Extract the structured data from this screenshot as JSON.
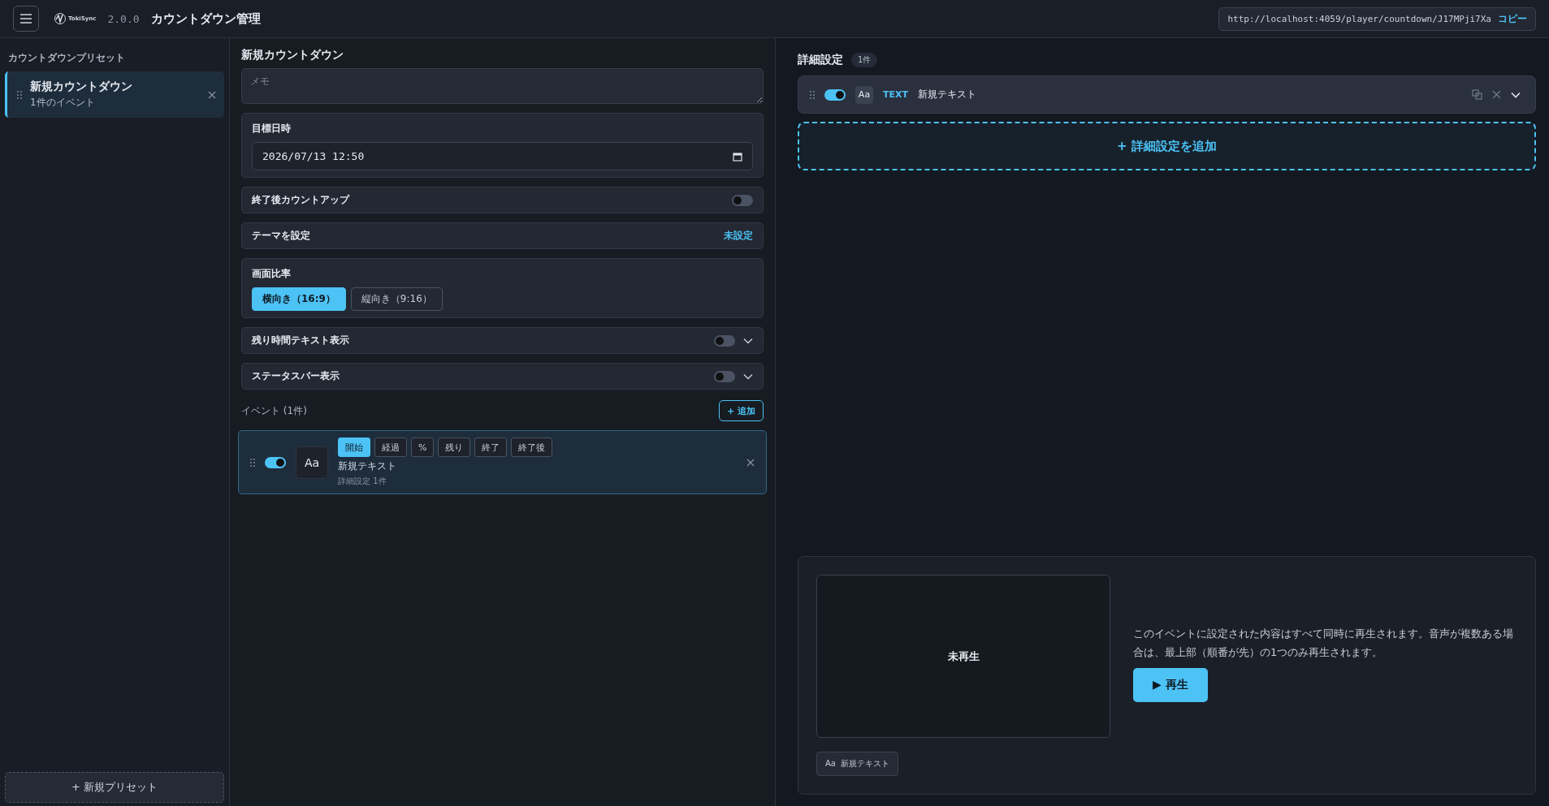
{
  "header": {
    "logo_text": "TokiSync",
    "version": "2.0.0",
    "title": "カウントダウン管理",
    "url": "http://localhost:4059/player/countdown/J17MPji7Xa",
    "copy_label": "コピー"
  },
  "sidebar": {
    "title": "カウントダウンプリセット",
    "presets": [
      {
        "name": "新規カウントダウン",
        "subtitle": "1件のイベント",
        "selected": true
      }
    ],
    "new_button": "+ 新規プリセット"
  },
  "editor": {
    "title": "新規カウントダウン",
    "memo": {
      "placeholder": "メモ"
    },
    "target": {
      "label": "目標日時",
      "value": "2026/07/13 12:50"
    },
    "settings": [
      {
        "kind": "toggle",
        "label": "終了後カウントアップ",
        "on": false
      },
      {
        "kind": "link",
        "label": "テーマを設定",
        "value": "未設定"
      },
      {
        "kind": "ratio",
        "label": "画面比率",
        "options": [
          {
            "label": "横向き（16:9）",
            "selected": true
          },
          {
            "label": "縦向き（9:16）",
            "selected": false
          }
        ]
      },
      {
        "kind": "toggle_expand",
        "label": "残り時間テキスト表示",
        "on": false
      },
      {
        "kind": "toggle_expand",
        "label": "ステータスバー表示",
        "on": false
      }
    ],
    "events_label": "イベント (1件)",
    "add_button": "+ 追加",
    "events": [
      {
        "on": true,
        "icon_text": "Aa",
        "triggers": [
          {
            "label": "開始",
            "selected": true
          },
          {
            "label": "経過",
            "selected": false
          },
          {
            "label": "%",
            "selected": false
          },
          {
            "label": "残り",
            "selected": false
          },
          {
            "label": "終了",
            "selected": false
          },
          {
            "label": "終了後",
            "selected": false
          }
        ],
        "name": "新規テキスト",
        "detail": "詳細設定 1件",
        "selected": true
      }
    ]
  },
  "details": {
    "title": "詳細設定",
    "count": "1件",
    "items": [
      {
        "on": true,
        "icon_text": "Aa",
        "type": "TEXT",
        "name": "新規テキスト"
      }
    ],
    "add_button": "+ 詳細設定を追加"
  },
  "preview": {
    "status": "未再生",
    "note": "このイベントに設定された内容はすべて同時に再生されます。音声が複数ある場合は、最上部（順番が先）の1つのみ再生されます。",
    "play_button": "▶ 再生",
    "chips": [
      {
        "icon_text": "Aa",
        "label": "新規テキスト"
      }
    ]
  }
}
